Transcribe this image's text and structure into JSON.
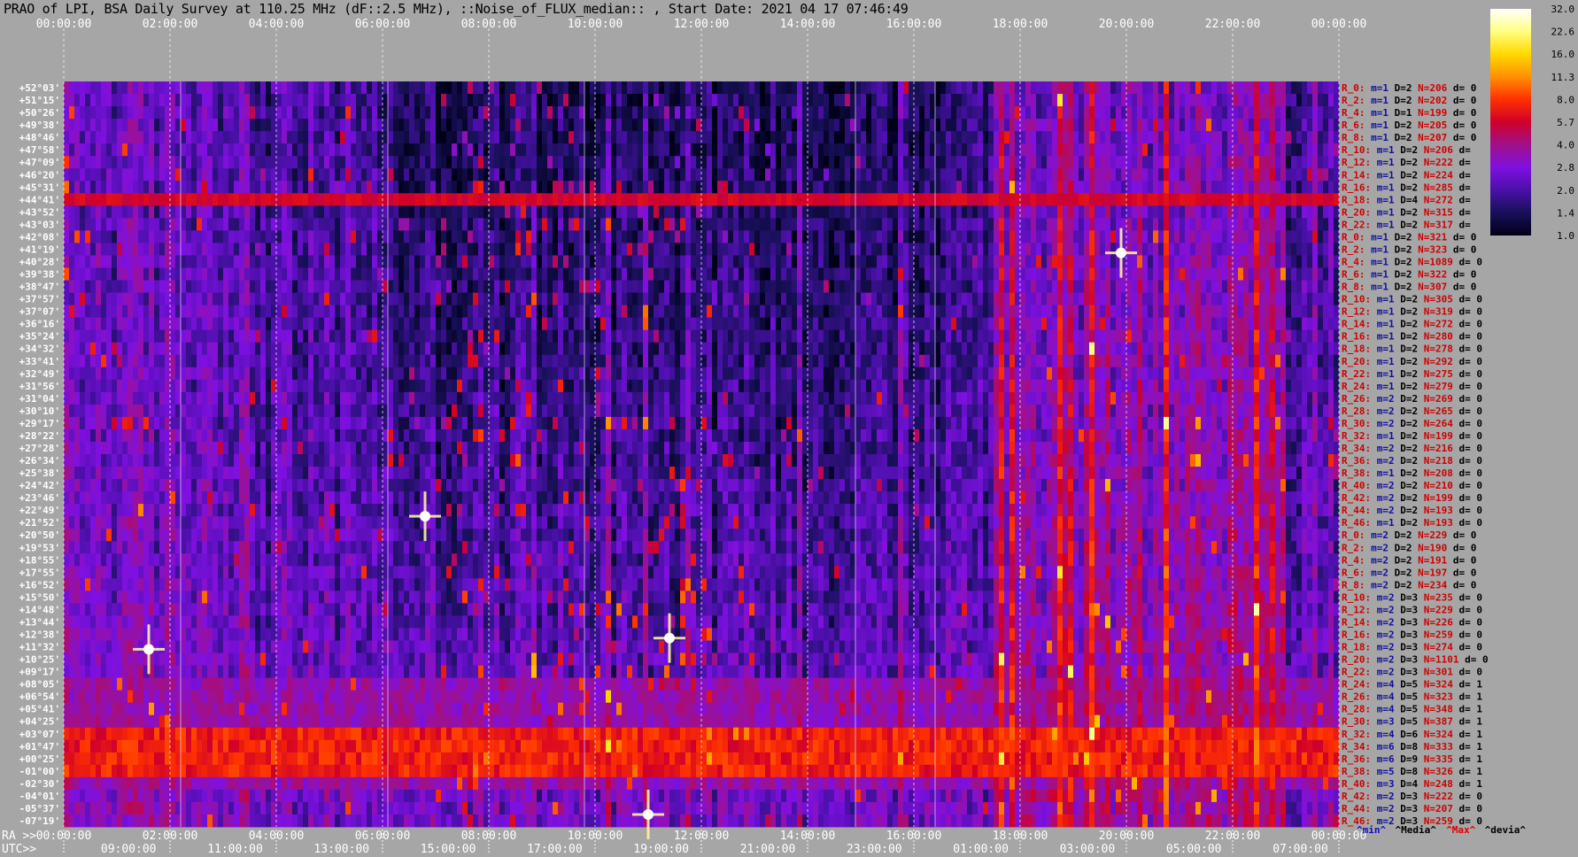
{
  "title": "PRAO of LPI, BSA Daily Survey at 110.25 MHz (dF::2.5 MHz), ::Noise_of_FLUX_median:: , Start Date: 2021 04 17 07:46:49",
  "chart_data": {
    "type": "heatmap",
    "title": "PRAO of LPI, BSA Daily Survey at 110.25 MHz (dF::2.5 MHz), ::Noise_of_FLUX_median:: , Start Date: 2021 04 17 07:46:49",
    "x_top_ticks": [
      "00:00:00",
      "02:00:00",
      "04:00:00",
      "06:00:00",
      "08:00:00",
      "10:00:00",
      "12:00:00",
      "14:00:00",
      "16:00:00",
      "18:00:00",
      "20:00:00",
      "22:00:00",
      "00:00:00"
    ],
    "ra_axis_prefix": "RA >>",
    "ra_ticks": [
      "00:00:00",
      "02:00:00",
      "04:00:00",
      "06:00:00",
      "08:00:00",
      "10:00:00",
      "12:00:00",
      "14:00:00",
      "16:00:00",
      "18:00:00",
      "20:00:00",
      "22:00:00",
      "00:00:00"
    ],
    "utc_axis_prefix": "UTC>>",
    "utc_ticks": [
      "09:00:00",
      "11:00:00",
      "13:00:00",
      "15:00:00",
      "17:00:00",
      "19:00:00",
      "21:00:00",
      "23:00:00",
      "01:00:00",
      "03:00:00",
      "05:00:00",
      "07:00:00"
    ],
    "declinations": [
      "+52°03'",
      "+51°15'",
      "+50°26'",
      "+49°38'",
      "+48°46'",
      "+47°58'",
      "+47°09'",
      "+46°20'",
      "+45°31'",
      "+44°41'",
      "+43°52'",
      "+43°03'",
      "+42°08'",
      "+41°19'",
      "+40°28'",
      "+39°38'",
      "+38°47'",
      "+37°57'",
      "+37°07'",
      "+36°16'",
      "+35°24'",
      "+34°32'",
      "+33°41'",
      "+32°49'",
      "+31°56'",
      "+31°04'",
      "+30°10'",
      "+29°17'",
      "+28°22'",
      "+27°28'",
      "+26°34'",
      "+25°38'",
      "+24°42'",
      "+23°46'",
      "+22°49'",
      "+21°52'",
      "+20°50'",
      "+19°53'",
      "+18°55'",
      "+17°55'",
      "+16°52'",
      "+15°50'",
      "+14°48'",
      "+13°44'",
      "+12°38'",
      "+11°32'",
      "+10°25'",
      "+09°17'",
      "+08°05'",
      "+06°54'",
      "+05°41'",
      "+04°25'",
      "+03°07'",
      "+01°47'",
      "+00°25'",
      "-01°00'",
      "-02°30'",
      "-04°01'",
      "-05°37'",
      "-07°19'"
    ],
    "row_stats": [
      {
        "r": "R_0:",
        "m": "m=1",
        "d": "D=2",
        "n": "N=206",
        "dev": "d= 0"
      },
      {
        "r": "R_2:",
        "m": "m=1",
        "d": "D=2",
        "n": "N=202",
        "dev": "d= 0"
      },
      {
        "r": "R_4:",
        "m": "m=1",
        "d": "D=1",
        "n": "N=199",
        "dev": "d= 0"
      },
      {
        "r": "R_6:",
        "m": "m=1",
        "d": "D=2",
        "n": "N=205",
        "dev": "d= 0"
      },
      {
        "r": "R_8:",
        "m": "m=1",
        "d": "D=2",
        "n": "N=207",
        "dev": "d= 0"
      },
      {
        "r": "R_10:",
        "m": "m=1",
        "d": "D=2",
        "n": "N=206",
        "dev": "d="
      },
      {
        "r": "R_12:",
        "m": "m=1",
        "d": "D=2",
        "n": "N=222",
        "dev": "d="
      },
      {
        "r": "R_14:",
        "m": "m=1",
        "d": "D=2",
        "n": "N=224",
        "dev": "d="
      },
      {
        "r": "R_16:",
        "m": "m=1",
        "d": "D=2",
        "n": "N=285",
        "dev": "d="
      },
      {
        "r": "R_18:",
        "m": "m=1",
        "d": "D=4",
        "n": "N=272",
        "dev": "d="
      },
      {
        "r": "R_20:",
        "m": "m=1",
        "d": "D=2",
        "n": "N=315",
        "dev": "d="
      },
      {
        "r": "R_22:",
        "m": "m=1",
        "d": "D=2",
        "n": "N=317",
        "dev": "d="
      },
      {
        "r": "R_0:",
        "m": "m=1",
        "d": "D=2",
        "n": "N=321",
        "dev": "d= 0"
      },
      {
        "r": "R_2:",
        "m": "m=1",
        "d": "D=2",
        "n": "N=323",
        "dev": "d= 0"
      },
      {
        "r": "R_4:",
        "m": "m=1",
        "d": "D=2",
        "n": "N=1089",
        "dev": "d= 0"
      },
      {
        "r": "R_6:",
        "m": "m=1",
        "d": "D=2",
        "n": "N=322",
        "dev": "d= 0"
      },
      {
        "r": "R_8:",
        "m": "m=1",
        "d": "D=2",
        "n": "N=307",
        "dev": "d= 0"
      },
      {
        "r": "R_10:",
        "m": "m=1",
        "d": "D=2",
        "n": "N=305",
        "dev": "d= 0"
      },
      {
        "r": "R_12:",
        "m": "m=1",
        "d": "D=2",
        "n": "N=319",
        "dev": "d= 0"
      },
      {
        "r": "R_14:",
        "m": "m=1",
        "d": "D=2",
        "n": "N=272",
        "dev": "d= 0"
      },
      {
        "r": "R_16:",
        "m": "m=1",
        "d": "D=2",
        "n": "N=280",
        "dev": "d= 0"
      },
      {
        "r": "R_18:",
        "m": "m=1",
        "d": "D=2",
        "n": "N=278",
        "dev": "d= 0"
      },
      {
        "r": "R_20:",
        "m": "m=1",
        "d": "D=2",
        "n": "N=292",
        "dev": "d= 0"
      },
      {
        "r": "R_22:",
        "m": "m=1",
        "d": "D=2",
        "n": "N=275",
        "dev": "d= 0"
      },
      {
        "r": "R_24:",
        "m": "m=1",
        "d": "D=2",
        "n": "N=279",
        "dev": "d= 0"
      },
      {
        "r": "R_26:",
        "m": "m=2",
        "d": "D=2",
        "n": "N=269",
        "dev": "d= 0"
      },
      {
        "r": "R_28:",
        "m": "m=2",
        "d": "D=2",
        "n": "N=265",
        "dev": "d= 0"
      },
      {
        "r": "R_30:",
        "m": "m=2",
        "d": "D=2",
        "n": "N=264",
        "dev": "d= 0"
      },
      {
        "r": "R_32:",
        "m": "m=1",
        "d": "D=2",
        "n": "N=199",
        "dev": "d= 0"
      },
      {
        "r": "R_34:",
        "m": "m=2",
        "d": "D=2",
        "n": "N=216",
        "dev": "d= 0"
      },
      {
        "r": "R_36:",
        "m": "m=2",
        "d": "D=2",
        "n": "N=218",
        "dev": "d= 0"
      },
      {
        "r": "R_38:",
        "m": "m=1",
        "d": "D=2",
        "n": "N=208",
        "dev": "d= 0"
      },
      {
        "r": "R_40:",
        "m": "m=2",
        "d": "D=2",
        "n": "N=210",
        "dev": "d= 0"
      },
      {
        "r": "R_42:",
        "m": "m=2",
        "d": "D=2",
        "n": "N=199",
        "dev": "d= 0"
      },
      {
        "r": "R_44:",
        "m": "m=2",
        "d": "D=2",
        "n": "N=193",
        "dev": "d= 0"
      },
      {
        "r": "R_46:",
        "m": "m=1",
        "d": "D=2",
        "n": "N=193",
        "dev": "d= 0"
      },
      {
        "r": "R_0:",
        "m": "m=2",
        "d": "D=2",
        "n": "N=229",
        "dev": "d= 0"
      },
      {
        "r": "R_2:",
        "m": "m=2",
        "d": "D=2",
        "n": "N=190",
        "dev": "d= 0"
      },
      {
        "r": "R_4:",
        "m": "m=2",
        "d": "D=2",
        "n": "N=191",
        "dev": "d= 0"
      },
      {
        "r": "R_6:",
        "m": "m=2",
        "d": "D=2",
        "n": "N=197",
        "dev": "d= 0"
      },
      {
        "r": "R_8:",
        "m": "m=2",
        "d": "D=2",
        "n": "N=234",
        "dev": "d= 0"
      },
      {
        "r": "R_10:",
        "m": "m=2",
        "d": "D=3",
        "n": "N=235",
        "dev": "d= 0"
      },
      {
        "r": "R_12:",
        "m": "m=2",
        "d": "D=3",
        "n": "N=229",
        "dev": "d= 0"
      },
      {
        "r": "R_14:",
        "m": "m=2",
        "d": "D=3",
        "n": "N=226",
        "dev": "d= 0"
      },
      {
        "r": "R_16:",
        "m": "m=2",
        "d": "D=3",
        "n": "N=259",
        "dev": "d= 0"
      },
      {
        "r": "R_18:",
        "m": "m=2",
        "d": "D=3",
        "n": "N=274",
        "dev": "d= 0"
      },
      {
        "r": "R_20:",
        "m": "m=2",
        "d": "D=3",
        "n": "N=1101",
        "dev": "d= 0"
      },
      {
        "r": "R_22:",
        "m": "m=2",
        "d": "D=3",
        "n": "N=301",
        "dev": "d= 0"
      },
      {
        "r": "R_24:",
        "m": "m=4",
        "d": "D=5",
        "n": "N=324",
        "dev": "d= 1"
      },
      {
        "r": "R_26:",
        "m": "m=4",
        "d": "D=5",
        "n": "N=323",
        "dev": "d= 1"
      },
      {
        "r": "R_28:",
        "m": "m=4",
        "d": "D=5",
        "n": "N=348",
        "dev": "d= 1"
      },
      {
        "r": "R_30:",
        "m": "m=3",
        "d": "D=5",
        "n": "N=387",
        "dev": "d= 1"
      },
      {
        "r": "R_32:",
        "m": "m=4",
        "d": "D=6",
        "n": "N=324",
        "dev": "d= 1"
      },
      {
        "r": "R_34:",
        "m": "m=6",
        "d": "D=8",
        "n": "N=333",
        "dev": "d= 1"
      },
      {
        "r": "R_36:",
        "m": "m=6",
        "d": "D=9",
        "n": "N=335",
        "dev": "d= 1"
      },
      {
        "r": "R_38:",
        "m": "m=5",
        "d": "D=8",
        "n": "N=326",
        "dev": "d= 1"
      },
      {
        "r": "R_40:",
        "m": "m=3",
        "d": "D=4",
        "n": "N=248",
        "dev": "d= 1"
      },
      {
        "r": "R_42:",
        "m": "m=2",
        "d": "D=3",
        "n": "N=222",
        "dev": "d= 0"
      },
      {
        "r": "R_44:",
        "m": "m=2",
        "d": "D=3",
        "n": "N=207",
        "dev": "d= 0"
      },
      {
        "r": "R_46:",
        "m": "m=2",
        "d": "D=3",
        "n": "N=259",
        "dev": "d= 0"
      }
    ],
    "colorbar": {
      "labels": [
        "32.0",
        "22.6",
        "16.0",
        "11.3",
        "8.0",
        "5.7",
        "4.0",
        "2.8",
        "2.0",
        "1.4",
        "1.0"
      ],
      "colors": [
        "#ffffff",
        "#ffff80",
        "#ffd800",
        "#ff9000",
        "#ff3000",
        "#d0002a",
        "#a0108a",
        "#7e10e0",
        "#4a10a8",
        "#181058",
        "#000018"
      ],
      "scale": "log"
    },
    "legend_words": [
      {
        "text": "^min^",
        "color": "#1010c0"
      },
      {
        "text": "^Media^",
        "color": "#000000"
      },
      {
        "text": "^Max^",
        "color": "#e00000"
      },
      {
        "text": "^devia^",
        "color": "#000000"
      }
    ],
    "features": {
      "horizontal_band_row": 9,
      "bright_band_rows": [
        48,
        56
      ],
      "bright_sources": [
        {
          "ra_hours": 1.6,
          "row": 45.7
        },
        {
          "ra_hours": 19.9,
          "row": 13.8
        },
        {
          "ra_hours": 6.8,
          "row": 35
        },
        {
          "ra_hours": 11.4,
          "row": 44.8
        },
        {
          "ra_hours": 11.0,
          "row": 59
        }
      ]
    }
  }
}
